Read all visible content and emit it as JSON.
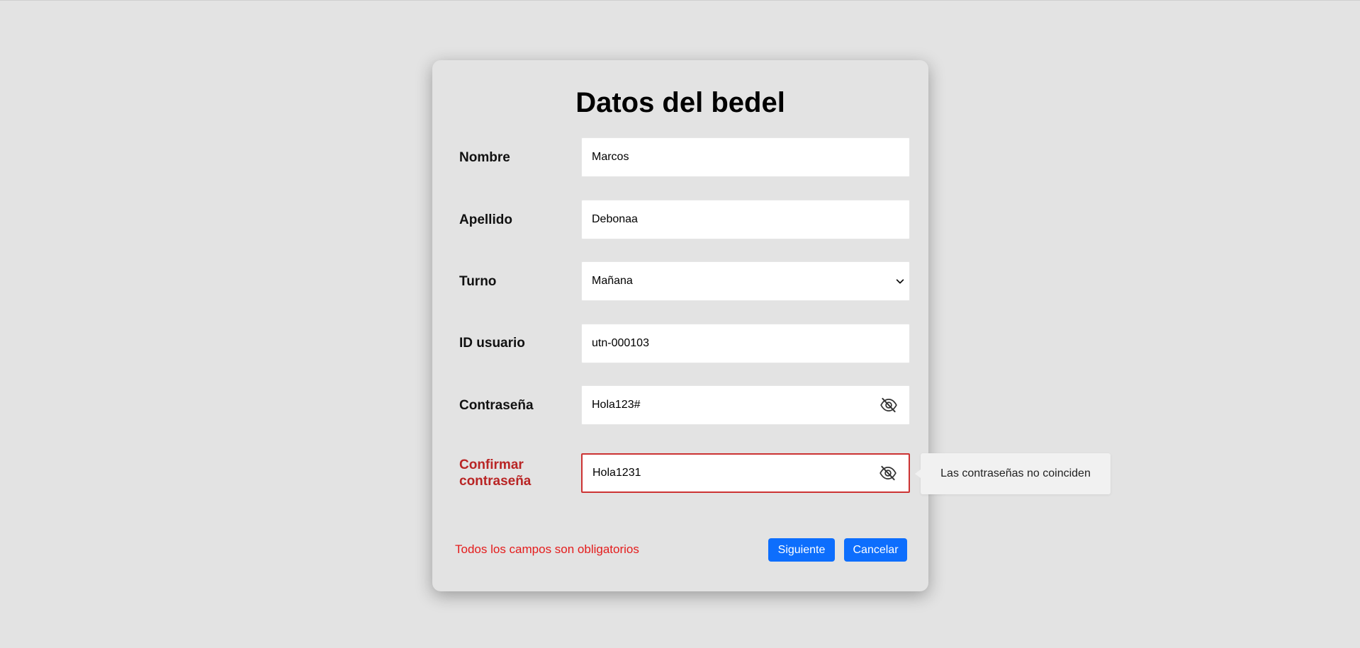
{
  "form": {
    "title": "Datos del bedel",
    "fields": {
      "nombre": {
        "label": "Nombre",
        "value": "Marcos"
      },
      "apellido": {
        "label": "Apellido",
        "value": "Debonaa"
      },
      "turno": {
        "label": "Turno",
        "value": "Mañana"
      },
      "id_usuario": {
        "label": "ID usuario",
        "value": "utn-000103"
      },
      "contrasena": {
        "label": "Contraseña",
        "value": "Hola123#"
      },
      "confirmar": {
        "label_line1": "Confirmar",
        "label_line2": "contraseña",
        "value": "Hola1231",
        "error_tooltip": "Las contraseñas no coinciden"
      }
    },
    "required_note": "Todos los campos son obligatorios",
    "buttons": {
      "next": "Siguiente",
      "cancel": "Cancelar"
    }
  },
  "colors": {
    "background": "#e3e3e3",
    "primary_button": "#0d6efd",
    "error_label": "#b92525",
    "error_note": "#e41c1c"
  },
  "icons": {
    "password_toggle": "eye-slash-icon",
    "select_arrow": "chevron-down-icon"
  }
}
